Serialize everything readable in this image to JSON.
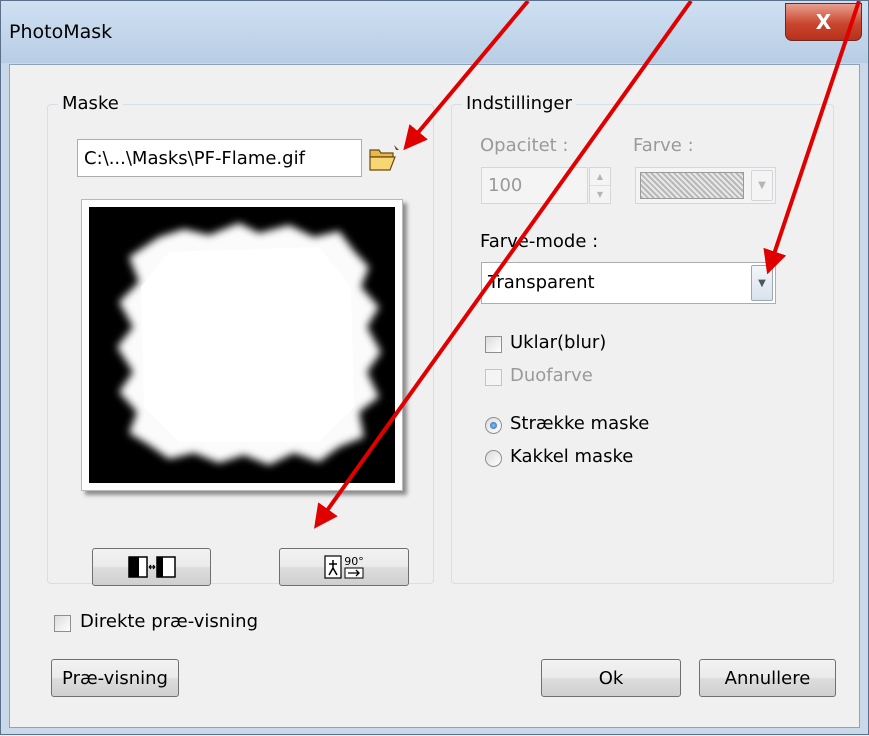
{
  "window": {
    "title": "PhotoMask",
    "close_label": "X"
  },
  "mask_group": {
    "label": "Maske",
    "file_path": "C:\\...\\Masks\\PF-Flame.gif",
    "open_icon": "folder-open-icon",
    "invert_icon": "invert-mask-icon",
    "rotate_icon": "rotate-90-icon",
    "rotate_label": "90°"
  },
  "settings_group": {
    "label": "Indstillinger",
    "opacity_label": "Opacitet :",
    "opacity_value": "100",
    "color_label": "Farve :",
    "color_mode_label": "Farve-mode :",
    "color_mode_value": "Transparent",
    "blur_label": "Uklar(blur)",
    "blur_checked": false,
    "duotone_label": "Duofarve",
    "duotone_checked": false,
    "stretch_label": "Strække maske",
    "stretch_checked": true,
    "tile_label": "Kakkel maske",
    "tile_checked": false
  },
  "footer": {
    "live_preview_label": "Direkte præ-visning",
    "live_preview_checked": false,
    "preview_button": "Præ-visning",
    "ok_button": "Ok",
    "cancel_button": "Annullere"
  },
  "colors": {
    "annotation_arrow": "#e00000",
    "close_button": "#c9452e",
    "radio_selected": "#1b5fa6"
  }
}
